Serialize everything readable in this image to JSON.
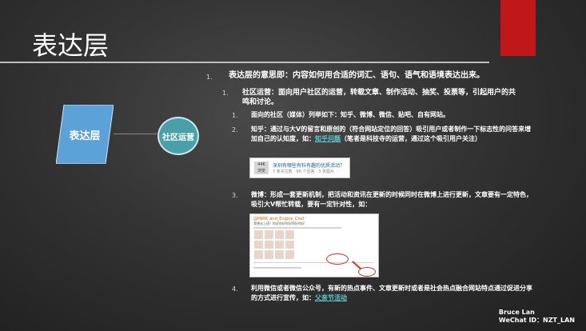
{
  "slide": {
    "title": "表达层",
    "diagram": {
      "box_label": "表达层",
      "circle_label": "社区运营"
    },
    "outline": {
      "l1_num": "1.",
      "l1_text": "表达层的意思即：内容如何用合适的词汇、语句、语气和语境表达出来。",
      "l2_num": "1.",
      "l2_line1": "社区运营：面向用户社区的运营，转载文章、制作活动、抽奖、投票等，引起用户的共",
      "l2_line2": "鸣和讨论。",
      "items": [
        {
          "num": "1.",
          "line1": "面向的社区（媒体）列举如下：知乎、微博、微信、贴吧、自有网站。"
        },
        {
          "num": "2.",
          "line1": "知乎：通过与大V的留言和原创的（符合网站定位的回答）吸引用户或者制作一下标志性的问答来增",
          "line2_prefix": "加自己的认知度，如：",
          "link": "知乎问题",
          "line2_suffix": "（笔者是科技寺的运营，通过这个吸引用户关注）"
        },
        {
          "num": "3.",
          "line1": "微博：形成一套更新机制，把活动和资讯在更新的时候同时在微博上进行更新，文章要有一定特色，",
          "line2": "吸引大V帮忙转载，要有一定针对性，如："
        },
        {
          "num": "4.",
          "line1": "利用微信或者微信公众号，有新的热点事件、文章更新时或者是社会热点融合网站特点通过促进分享",
          "line2_prefix": "的方式进行宣传，如：",
          "link": "父亲节活动"
        }
      ]
    },
    "zhihu_card": {
      "badge_count": "44K",
      "badge_unit": "浏览",
      "question": "深圳有哪些有料有趣的优质活动？",
      "meta": "7 条关注数 · 96 个回答 · 3 张图片"
    },
    "weibo_card": {
      "username": "@PARK_and_Engine_Chef",
      "text": "我想去上班！你好你好你好你好你好"
    },
    "footer": {
      "name": "Bruce Lan",
      "wechat": "WeChat ID：NZT_LAN"
    }
  }
}
